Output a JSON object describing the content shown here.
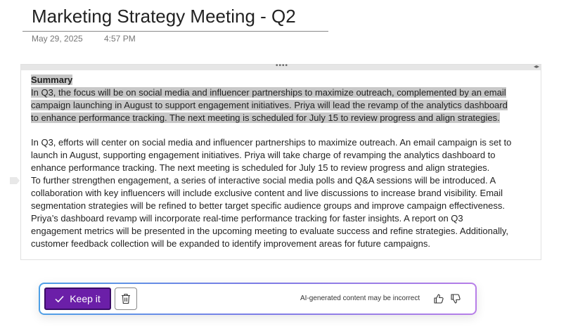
{
  "page": {
    "title": "Marketing Strategy Meeting - Q2",
    "date": "May 29, 2025",
    "time": "4:57 PM"
  },
  "container": {
    "drag_handle_glyph": "••••",
    "resize_handle_glyph": "◂▸"
  },
  "summary": {
    "heading": "Summary",
    "lines": [
      "In Q3, the focus will be on social media and influencer partnerships to maximize outreach, complemented by an email",
      "campaign launching in August to support engagement initiatives. Priya will lead the revamp of the analytics dashboard",
      "to enhance performance tracking. The next meeting is scheduled for July 15 to review progress and align strategies."
    ]
  },
  "body": {
    "lines": [
      "In Q3, efforts will center on social media and influencer partnerships to maximize outreach. An email campaign is set to",
      "launch in August, supporting engagement initiatives. Priya will take charge of revamping the analytics dashboard to",
      "enhance performance tracking. The next meeting is scheduled for July 15 to review progress and align strategies.",
      "To further strengthen engagement, a series of interactive social media polls and Q&A sessions will be introduced. A",
      "collaboration with key influencers will include exclusive content and live discussions to increase brand visibility. Email",
      "segmentation strategies will be refined to better target specific audience groups and improve campaign effectiveness.",
      "Priya’s dashboard revamp will incorporate real-time performance tracking for faster insights. A report on Q3",
      "engagement metrics will be presented in the upcoming meeting to evaluate success and refine strategies. Additionally,",
      "customer feedback collection will be expanded to identify improvement areas for future campaigns."
    ]
  },
  "ai_bar": {
    "keep_label": "Keep it",
    "disclaimer": "AI-generated content may be incorrect",
    "colors": {
      "keep_button": "#6b1fa8",
      "border_gradient_start": "#4fa0e6",
      "border_gradient_end": "#b77ee8"
    },
    "icons": [
      "checkmark-icon",
      "trash-icon",
      "thumbs-up-icon",
      "thumbs-down-icon"
    ]
  }
}
